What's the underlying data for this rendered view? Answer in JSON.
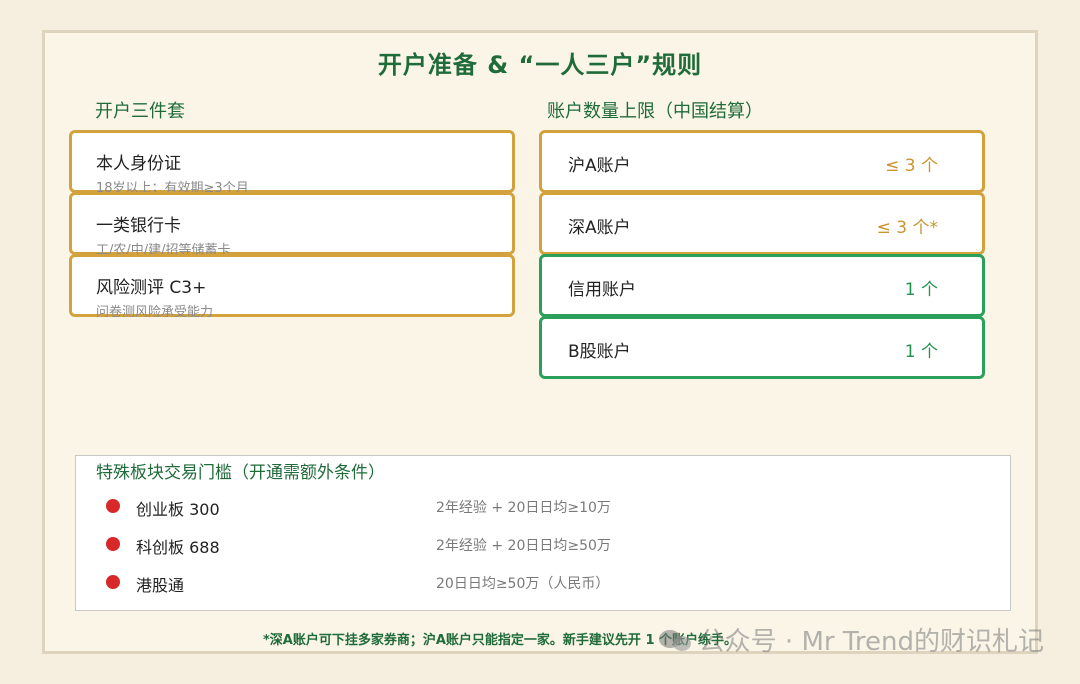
{
  "title": "开户准备 & “一人三户”规则",
  "left": {
    "label": "开户三件套",
    "cards": [
      {
        "main": "本人身份证",
        "sub": "18岁以上；有效期≥3个月"
      },
      {
        "main": "一类银行卡",
        "sub": "工/农/中/建/招等储蓄卡"
      },
      {
        "main": "风险测评 C3+",
        "sub": "问卷测风险承受能力"
      }
    ]
  },
  "right": {
    "label": "账户数量上限（中国结算）",
    "cards": [
      {
        "label": "沪A账户",
        "value": "≤ 3 个",
        "style": "gold"
      },
      {
        "label": "深A账户",
        "value": "≤ 3 个*",
        "style": "gold"
      },
      {
        "label": "信用账户",
        "value": "1 个",
        "style": "green"
      },
      {
        "label": "B股账户",
        "value": "1 个",
        "style": "green"
      }
    ]
  },
  "special": {
    "title": "特殊板块交易门槛（开通需额外条件）",
    "rows": [
      {
        "name": "创业板 300",
        "cond": "2年经验 + 20日日均≥10万"
      },
      {
        "name": "科创板 688",
        "cond": "2年经验 + 20日日均≥50万"
      },
      {
        "name": "港股通",
        "cond": "20日日均≥50万（人民币）"
      }
    ]
  },
  "footnote": "*深A账户可下挂多家券商；沪A账户只能指定一家。新手建议先开 1 个账户练手。",
  "watermark": "公众号 · Mr Trend的财识札记",
  "colors": {
    "title_green": "#1f6b3a",
    "gold_border": "#d3a23c",
    "green_border": "#2aa05a",
    "bullet_red": "#d7282a",
    "background": "#f6efdf"
  }
}
